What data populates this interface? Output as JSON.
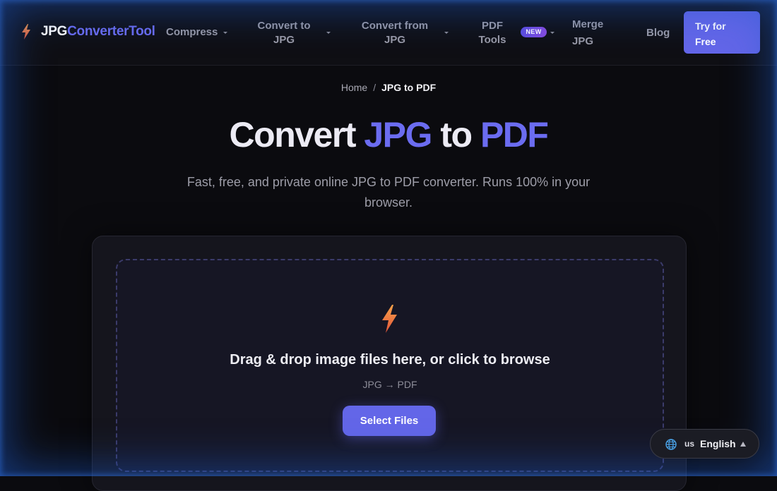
{
  "brand": {
    "part1": "JPG",
    "part2": "ConverterTool",
    "icon": "lightning-bolt-icon"
  },
  "nav": {
    "compress": "Compress",
    "convert_to_line1": "Convert to",
    "convert_to_line2": "JPG",
    "convert_from_line1": "Convert from",
    "convert_from_line2": "JPG",
    "pdf_tools_line1": "PDF",
    "pdf_tools_line2": "Tools",
    "new_badge": "NEW",
    "merge_line1": "Merge",
    "merge_line2": "JPG",
    "blog": "Blog",
    "cta_line1": "Try for",
    "cta_line2": "Free"
  },
  "breadcrumb": {
    "home": "Home",
    "separator": "/",
    "current": "JPG to PDF"
  },
  "hero": {
    "title_word1": "Convert",
    "title_word2": "JPG",
    "title_word3": "to",
    "title_word4": "PDF",
    "subtitle": "Fast, free, and private online JPG to PDF converter. Runs 100% in your browser."
  },
  "dropzone": {
    "icon": "lightning-bolt-icon",
    "main_text": "Drag & drop image files here, or click to browse",
    "sub_text": "JPG → PDF",
    "button_label": "Select Files"
  },
  "language": {
    "icon": "globe-icon",
    "code": "us",
    "name": "English"
  },
  "colors": {
    "accent": "#6366e8",
    "accent_text": "#6b6cf0",
    "background": "#0b0b0f",
    "bolt": "#ef7a3a"
  }
}
